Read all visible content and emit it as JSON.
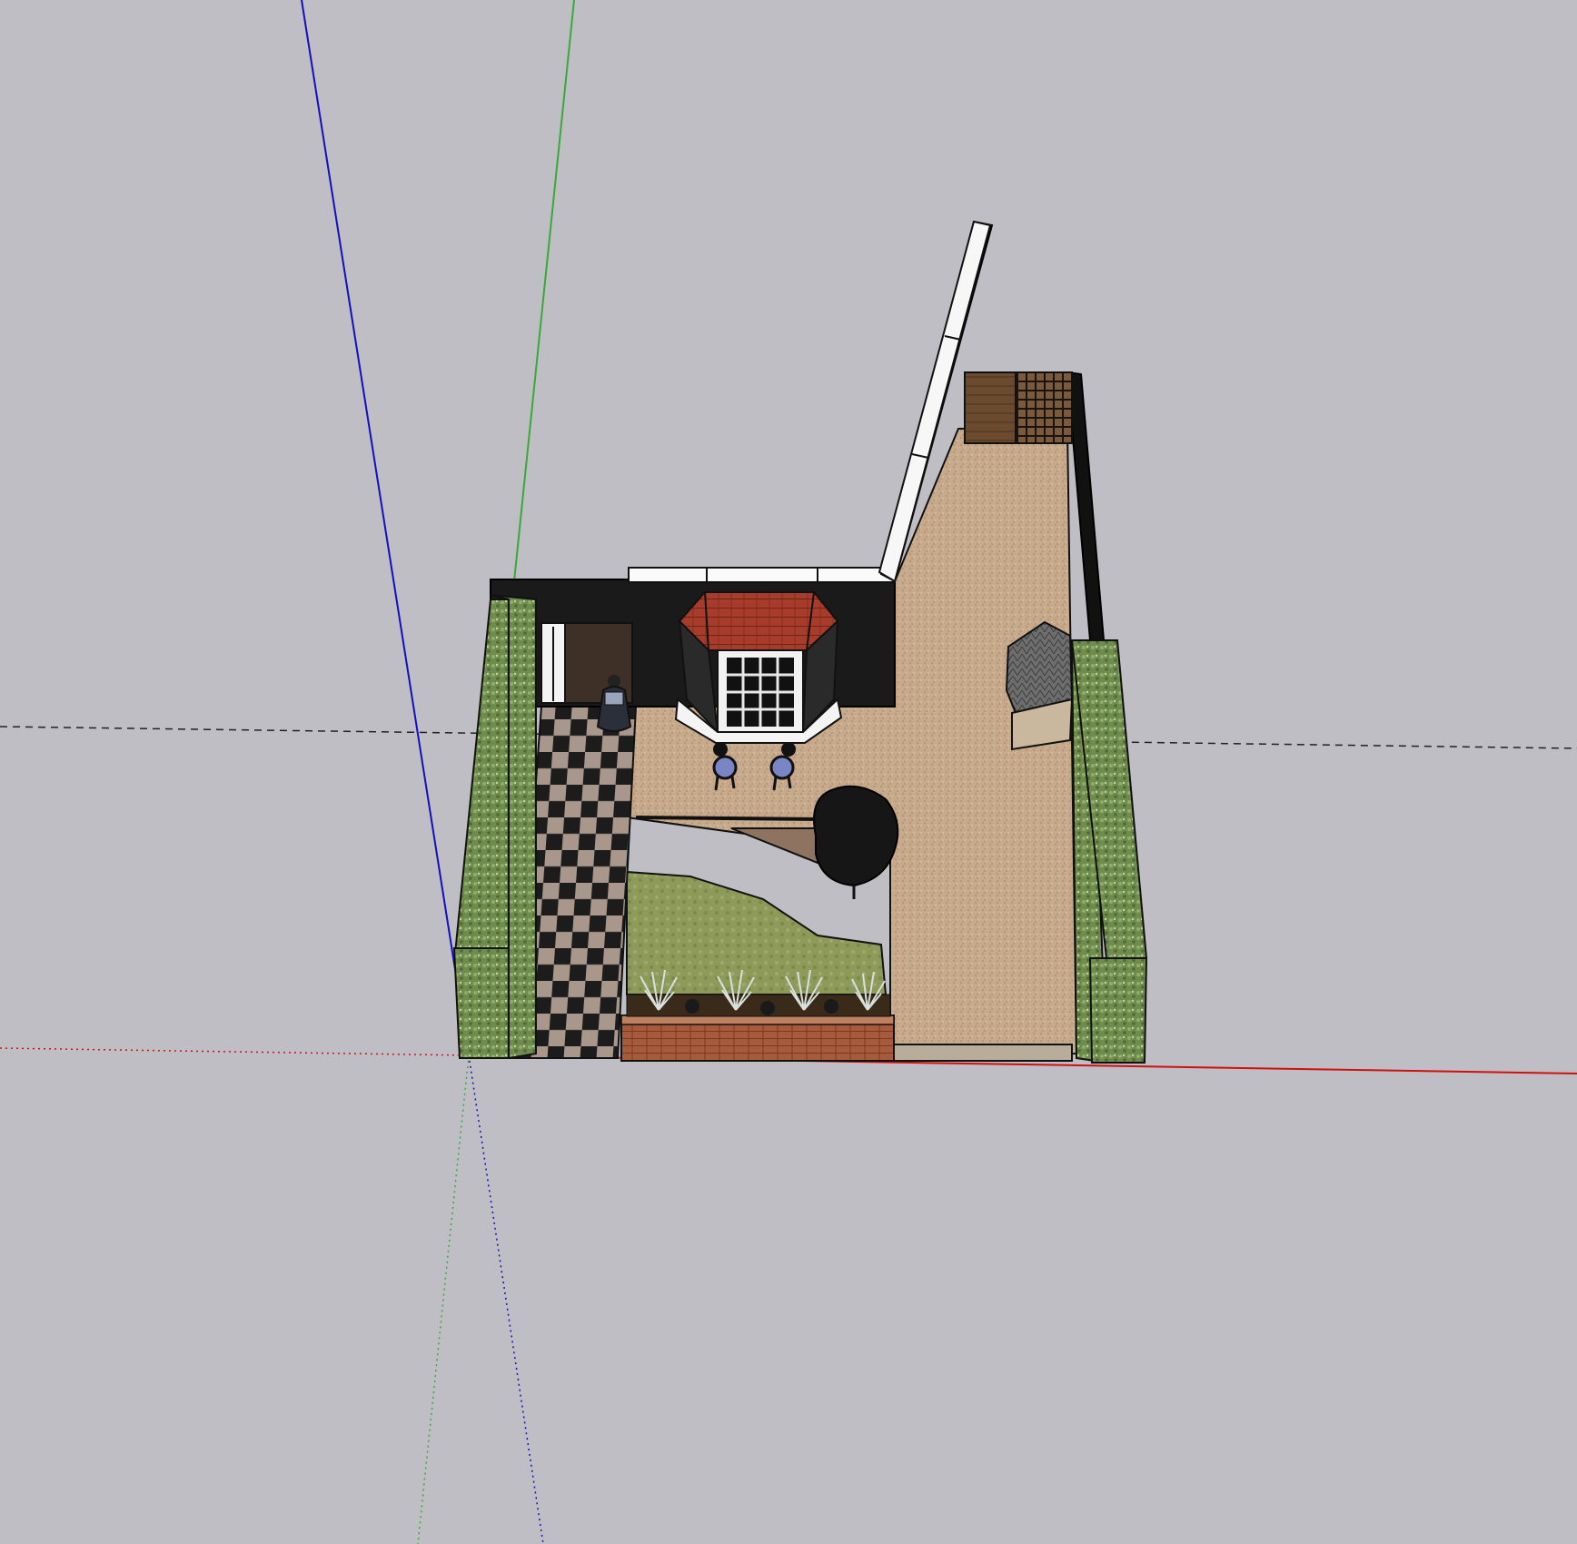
{
  "app": {
    "view": "3d-modeling-viewport"
  },
  "colors": {
    "background": "#bfbec4",
    "axis_red": "#d01010",
    "axis_green": "#3aa83a",
    "axis_blue": "#1010c0",
    "gravel": "#c8a98a",
    "hedge": "#6b8a4a",
    "roof": "#a43a28",
    "lawn": "#8f9a58",
    "brick": "#a55a3c",
    "dark_wall": "#1a1a1a"
  },
  "model": {
    "name": "garden-design-model",
    "components": [
      "left-hedge",
      "right-hedge",
      "checkered-path",
      "gravel-area",
      "bay-window",
      "back-wall",
      "side-wall",
      "wooden-gate",
      "trellis-panel",
      "garden-shed",
      "lawn-area",
      "brick-planter",
      "topiary-tree",
      "bistro-chair-left",
      "bistro-chair-right",
      "person-figure"
    ],
    "icons": [
      "person-icon",
      "tree-icon",
      "chair-icon",
      "grass-plant-icon"
    ]
  }
}
